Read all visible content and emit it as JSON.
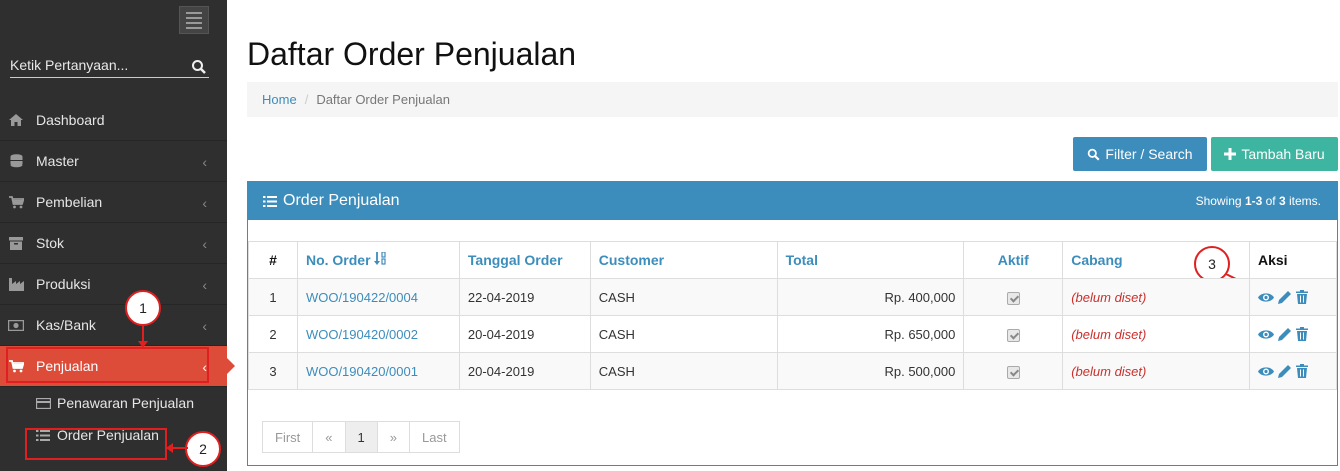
{
  "sidebar": {
    "search_placeholder": "Ketik Pertanyaan...",
    "items": [
      {
        "label": "Dashboard",
        "icon": "home-icon"
      },
      {
        "label": "Master",
        "icon": "database-icon"
      },
      {
        "label": "Pembelian",
        "icon": "cart-icon"
      },
      {
        "label": "Stok",
        "icon": "archive-icon"
      },
      {
        "label": "Produksi",
        "icon": "factory-icon"
      },
      {
        "label": "Kas/Bank",
        "icon": "money-icon"
      },
      {
        "label": "Penjualan",
        "icon": "cart-icon"
      }
    ],
    "sub_items": [
      {
        "label": "Penawaran Penjualan",
        "icon": "card-icon"
      },
      {
        "label": "Order Penjualan",
        "icon": "list-icon"
      }
    ]
  },
  "annotations": [
    "1",
    "2",
    "3"
  ],
  "header": {
    "title": "Daftar Order Penjualan"
  },
  "breadcrumb": {
    "home": "Home",
    "current": "Daftar Order Penjualan"
  },
  "buttons": {
    "filter": "Filter / Search",
    "add": "Tambah Baru"
  },
  "panel": {
    "title": "Order Penjualan",
    "showing_prefix": "Showing ",
    "showing_range": "1-3",
    "showing_of": " of ",
    "showing_total": "3",
    "showing_suffix": " items."
  },
  "table": {
    "columns": [
      "#",
      "No. Order",
      "Tanggal Order",
      "Customer",
      "Total",
      "Aktif",
      "Cabang",
      "Aksi"
    ],
    "rows": [
      {
        "no": "1",
        "order": "WOO/190422/0004",
        "date": "22-04-2019",
        "customer": "CASH",
        "total": "Rp. 400,000",
        "cabang": "(belum diset)"
      },
      {
        "no": "2",
        "order": "WOO/190420/0002",
        "date": "20-04-2019",
        "customer": "CASH",
        "total": "Rp. 650,000",
        "cabang": "(belum diset)"
      },
      {
        "no": "3",
        "order": "WOO/190420/0001",
        "date": "20-04-2019",
        "customer": "CASH",
        "total": "Rp. 500,000",
        "cabang": "(belum diset)"
      }
    ]
  },
  "pager": {
    "first": "First",
    "prev": "«",
    "page": "1",
    "next": "»",
    "last": "Last"
  },
  "colors": {
    "sidebar": "#2f2f2f",
    "active": "#dd4b39",
    "primary": "#3c8dbc",
    "success": "#3eb5a0",
    "annotation": "#e02020"
  }
}
